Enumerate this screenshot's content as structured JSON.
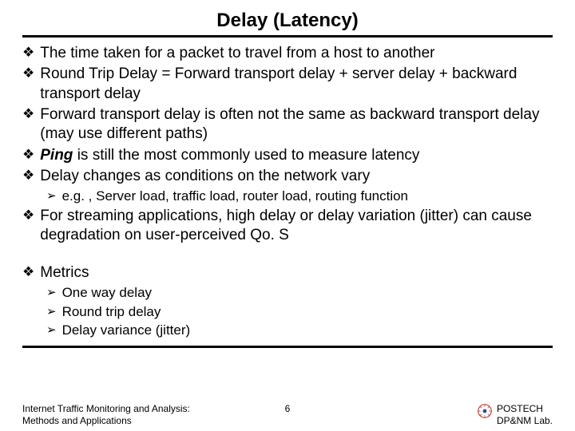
{
  "title": "Delay (Latency)",
  "bullets": {
    "b1": "The time taken for a packet to travel from a host to another",
    "b2": "Round Trip Delay = Forward transport delay + server delay + backward transport delay",
    "b3": "Forward transport delay is often not the same as backward transport delay (may use different paths)",
    "b4_term": "Ping",
    "b4_rest": " is still the most commonly used to measure latency",
    "b5": "Delay changes as conditions on the network vary",
    "b5_sub1": "e.g. , Server load, traffic load, router load, routing function",
    "b6": "For streaming applications, high delay or delay variation (jitter) can cause degradation on user-perceived Qo. S",
    "b7": "Metrics",
    "m1": "One way delay",
    "m2": "Round trip delay",
    "m3": "Delay variance (jitter)"
  },
  "glyphs": {
    "diamond": "❖",
    "arrow": "➢"
  },
  "footer": {
    "left_line1": "Internet Traffic Monitoring and Analysis:",
    "left_line2": "Methods and Applications",
    "page": "6",
    "right_line1": "POSTECH",
    "right_line2": "DP&NM Lab."
  }
}
